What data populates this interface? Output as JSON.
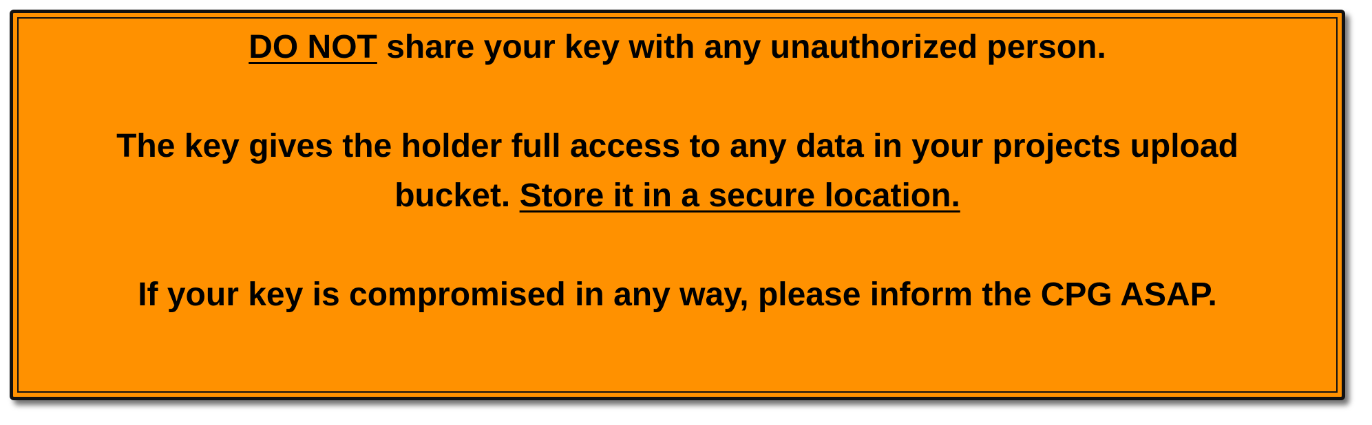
{
  "notice": {
    "para1": {
      "emphasis": "DO NOT",
      "rest": " share your key with any unauthorized person."
    },
    "para2": {
      "text": "The key gives the holder full access to any data in your projects upload bucket. ",
      "emphasis": "Store it in a secure location."
    },
    "para3": {
      "text": "If your key is compromised in any way, please inform the CPG ASAP."
    }
  },
  "colors": {
    "background": "#ff9100",
    "border": "#111111",
    "text": "#000000"
  }
}
